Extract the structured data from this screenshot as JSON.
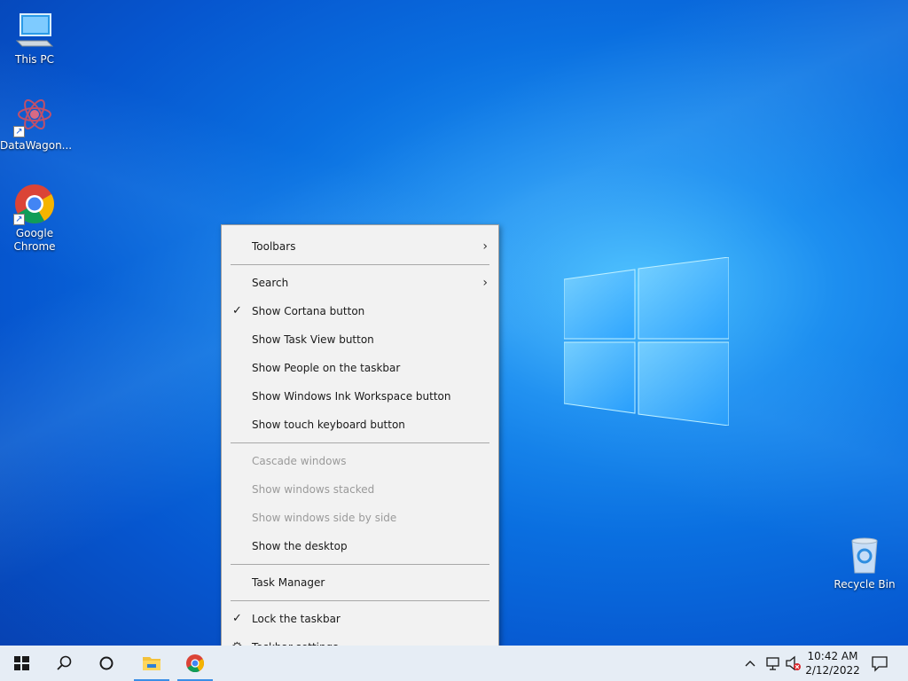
{
  "desktop": {
    "icons": [
      {
        "label": "This PC",
        "icon": "computer-icon"
      },
      {
        "label": "DataWagon...",
        "icon": "app-icon"
      },
      {
        "label": "Google Chrome",
        "icon": "chrome-icon"
      },
      {
        "label": "Recycle Bin",
        "icon": "recycle-bin-icon"
      }
    ]
  },
  "menu": {
    "toolbars": "Toolbars",
    "search": "Search",
    "show_cortana": "Show Cortana button",
    "show_task_view": "Show Task View button",
    "show_people": "Show People on the taskbar",
    "show_ink": "Show Windows Ink Workspace button",
    "show_touch_keyboard": "Show touch keyboard button",
    "cascade": "Cascade windows",
    "stacked": "Show windows stacked",
    "side_by_side": "Show windows side by side",
    "show_desktop": "Show the desktop",
    "task_manager": "Task Manager",
    "lock_taskbar": "Lock the taskbar",
    "taskbar_settings": "Taskbar settings",
    "check_glyph": "✓",
    "submenu_glyph": "›",
    "gear_glyph": "⚙"
  },
  "taskbar": {
    "time": "10:42 AM",
    "date": "2/12/2022",
    "colors": {
      "accent": "#3a8ee6",
      "background": "#e6edf5"
    }
  }
}
